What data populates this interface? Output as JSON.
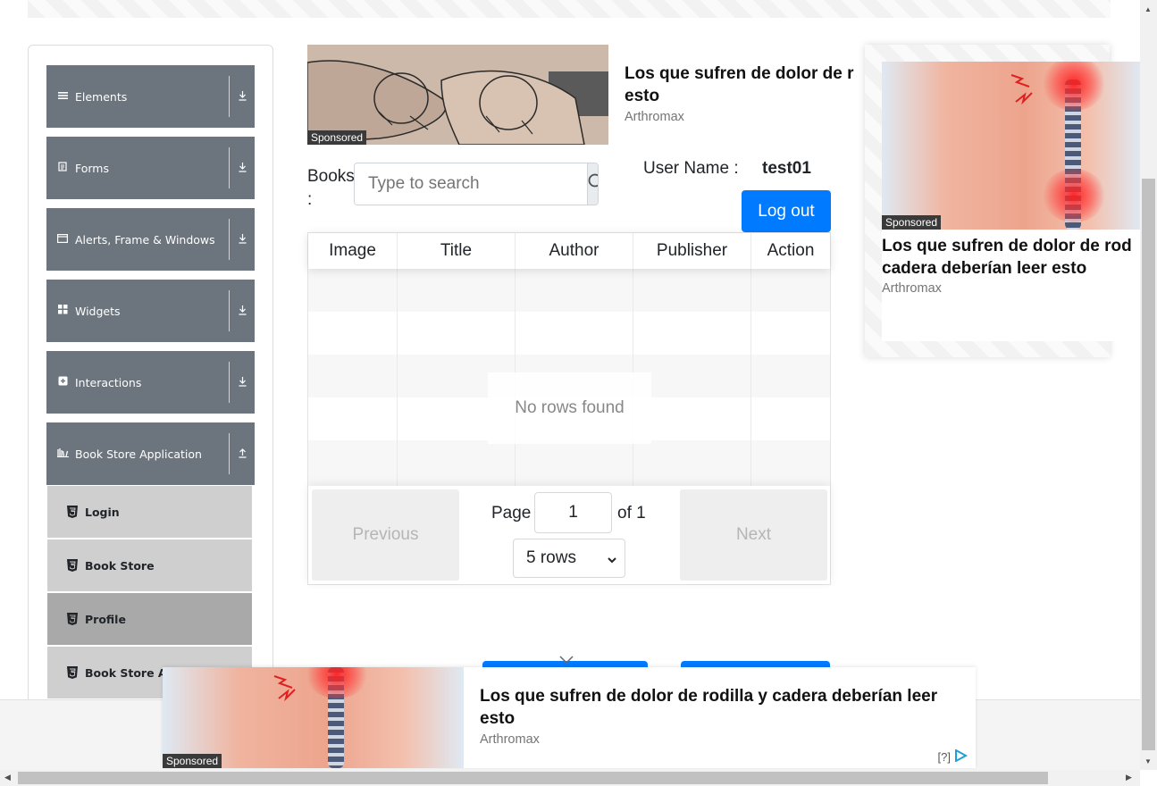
{
  "menu": {
    "groups": [
      {
        "label": "Elements",
        "icon": "hamburger-icon"
      },
      {
        "label": "Forms",
        "icon": "document-icon"
      },
      {
        "label": "Alerts, Frame & Windows",
        "icon": "window-icon"
      },
      {
        "label": "Widgets",
        "icon": "grid-icon"
      },
      {
        "label": "Interactions",
        "icon": "interaction-icon"
      },
      {
        "label": "Book Store Application",
        "icon": "books-icon"
      }
    ],
    "book_store_items": [
      {
        "label": "Login",
        "active": false
      },
      {
        "label": "Book Store",
        "active": false
      },
      {
        "label": "Profile",
        "active": true
      },
      {
        "label": "Book Store API",
        "active": false
      }
    ]
  },
  "ads": {
    "sponsored": "Sponsored",
    "top": {
      "title": "Los que sufren de dolor de rodilla y cadera deberían leer esto",
      "title_visible": "Los que sufren de dolor de r",
      "title_line2": "esto",
      "source": "Arthromax"
    },
    "right": {
      "title_line1": "Los que sufren de dolor de rod",
      "title_line2": "cadera deberían leer esto",
      "source": "Arthromax"
    },
    "bottom": {
      "title_line1": "Los que sufren de dolor de rodilla y cadera deberían leer",
      "title_line2": "esto",
      "source": "Arthromax",
      "choices": "[?]"
    }
  },
  "profile": {
    "books_label": "Books :",
    "search_placeholder": "Type to search",
    "user_name_label": "User Name :",
    "user_name": "test01",
    "logout": "Log out"
  },
  "table": {
    "columns": [
      "Image",
      "Title",
      "Author",
      "Publisher",
      "Action"
    ],
    "empty_message": "No rows found",
    "previous": "Previous",
    "next": "Next",
    "page_label": "Page",
    "page_value": "1",
    "of_label": "of 1",
    "rows_option": "5 rows"
  },
  "colors": {
    "primary": "#007bff",
    "menu_bg": "#6c757d",
    "sub_bg": "#cfcfcf",
    "active_bg": "#a9a9a9"
  }
}
